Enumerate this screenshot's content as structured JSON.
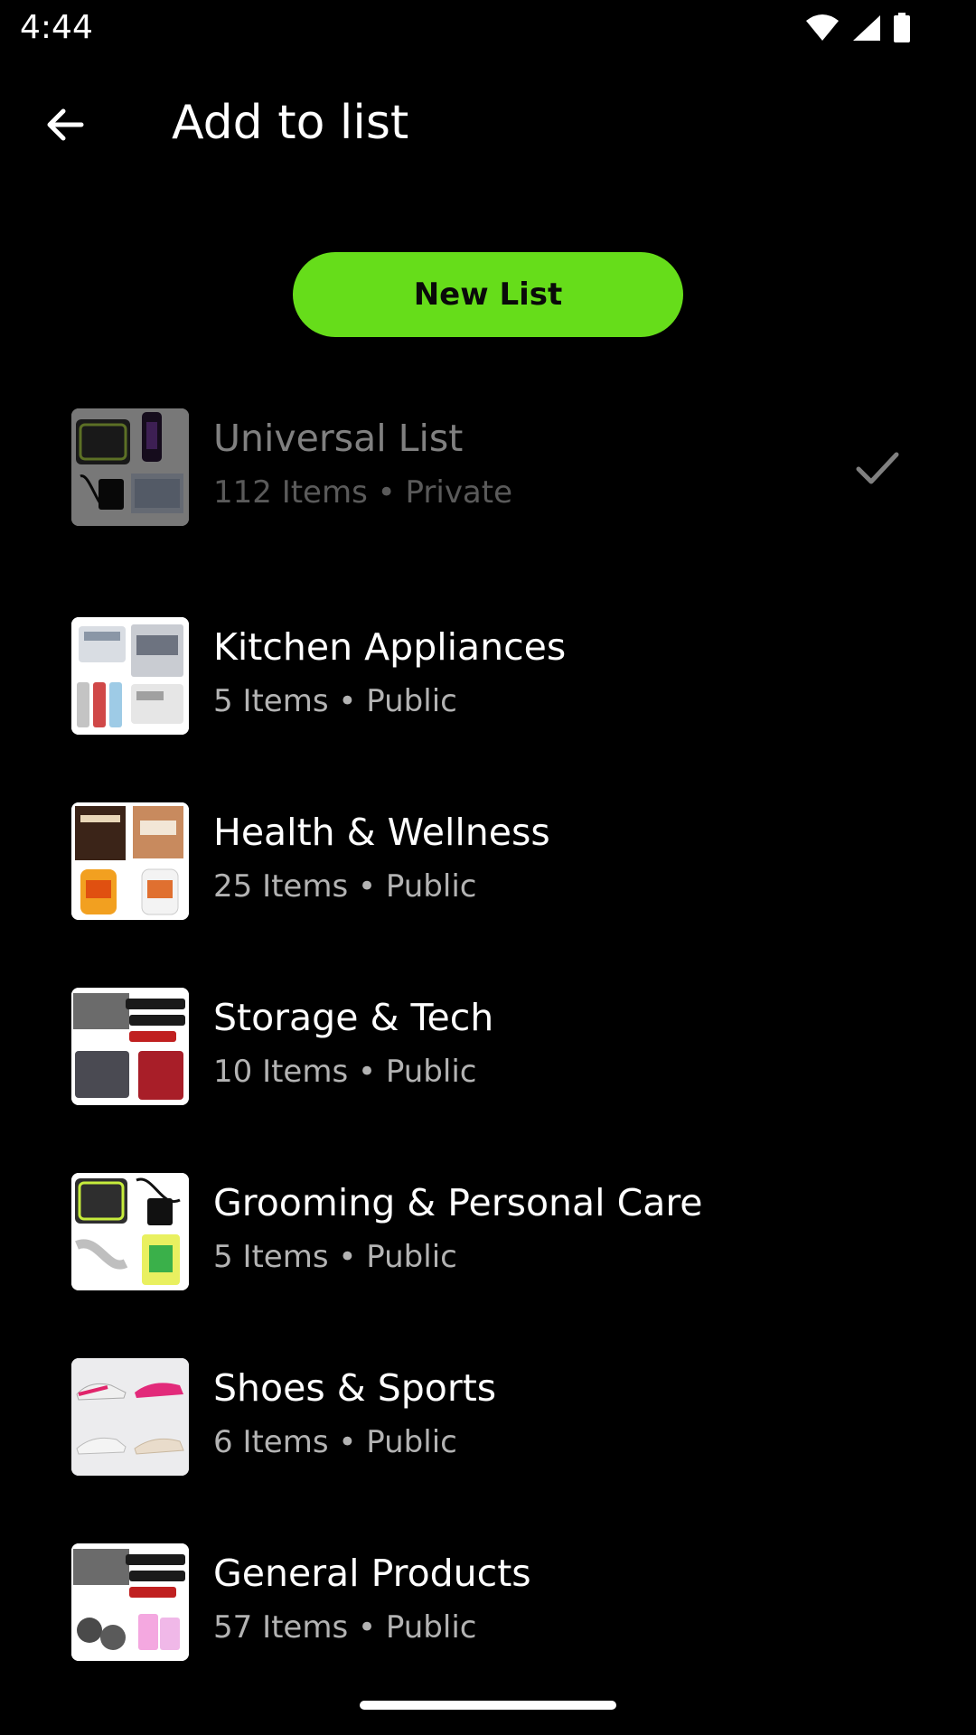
{
  "status_bar": {
    "time": "4:44"
  },
  "header": {
    "title": "Add to list",
    "back_icon": "arrow-back-icon"
  },
  "new_list_button": {
    "label": "New List",
    "color": "#66dd1a"
  },
  "lists": [
    {
      "name": "Universal List",
      "meta": "112 Items • Private",
      "selected": true
    },
    {
      "name": "Kitchen Appliances",
      "meta": "5 Items • Public",
      "selected": false
    },
    {
      "name": "Health & Wellness",
      "meta": "25 Items • Public",
      "selected": false
    },
    {
      "name": "Storage & Tech",
      "meta": "10 Items • Public",
      "selected": false
    },
    {
      "name": "Grooming & Personal Care",
      "meta": "5 Items • Public",
      "selected": false
    },
    {
      "name": "Shoes & Sports",
      "meta": "6 Items • Public",
      "selected": false
    },
    {
      "name": "General Products",
      "meta": "57 Items • Public",
      "selected": false
    }
  ],
  "colors": {
    "background": "#000000",
    "accent": "#66dd1a",
    "secondary_text": "#b3b3b3"
  }
}
